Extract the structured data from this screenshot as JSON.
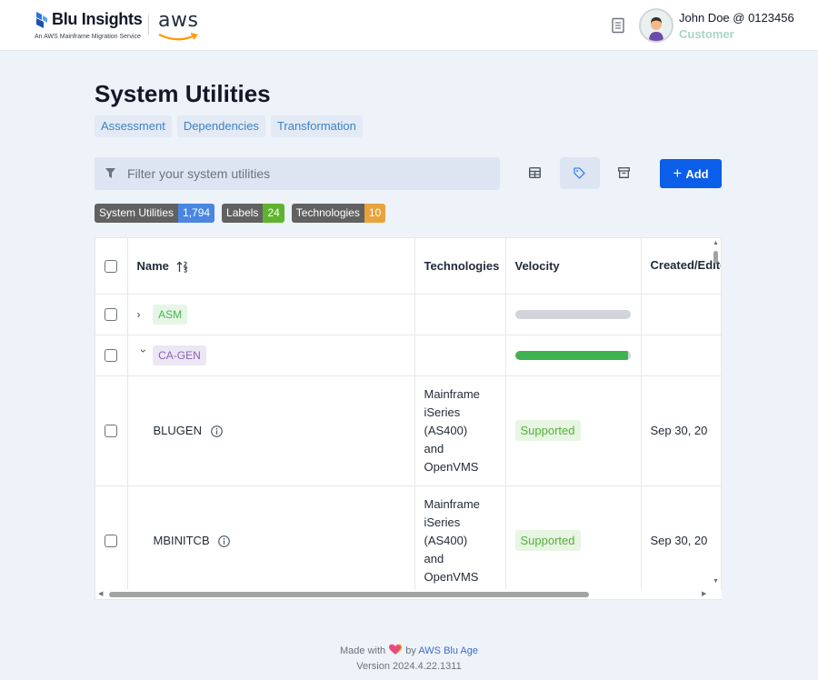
{
  "header": {
    "brand_title": "Blu Insights",
    "brand_subtitle": "An AWS Mainframe Migration Service",
    "partner_logo": "aws",
    "user_name": "John Doe @ 0123456",
    "user_role": "Customer"
  },
  "page": {
    "title": "System Utilities",
    "tabs": [
      "Assessment",
      "Dependencies",
      "Transformation"
    ]
  },
  "toolbar": {
    "filter_placeholder": "Filter your system utilities",
    "view_icons": [
      "table-icon",
      "tag-icon",
      "archive-icon"
    ],
    "add_label": "Add",
    "accent_color": "#0b5ee8"
  },
  "badges": [
    {
      "label": "System Utilities",
      "count": "1,794",
      "color": "#4a86e0"
    },
    {
      "label": "Labels",
      "count": "24",
      "color": "#5fb32e"
    },
    {
      "label": "Technologies",
      "count": "10",
      "color": "#e8a33a"
    }
  ],
  "table": {
    "columns": [
      "Name",
      "Technologies",
      "Velocity",
      "Created/Edited At"
    ],
    "groups": [
      {
        "name": "ASM",
        "expanded": false,
        "velocity": 0,
        "tag_bg": "#e6f6e6",
        "tag_fg": "#4caf50"
      },
      {
        "name": "CA-GEN",
        "expanded": true,
        "velocity": 0.99,
        "tag_bg": "#ece6f5",
        "tag_fg": "#8a63b8"
      }
    ],
    "rows": [
      {
        "name": "BLUGEN",
        "technologies": [
          "Mainframe",
          "iSeries",
          "(AS400)",
          "and",
          "OpenVMS"
        ],
        "velocity": "Supported",
        "date": "Sep 30, 20"
      },
      {
        "name": "MBINITCB",
        "technologies": [
          "Mainframe",
          "iSeries",
          "(AS400)",
          "and",
          "OpenVMS"
        ],
        "velocity": "Supported",
        "date": "Sep 30, 20"
      }
    ]
  },
  "footer": {
    "made_with": "Made with",
    "by": "by",
    "company": "AWS Blu Age",
    "version": "Version 2024.4.22.1311"
  }
}
